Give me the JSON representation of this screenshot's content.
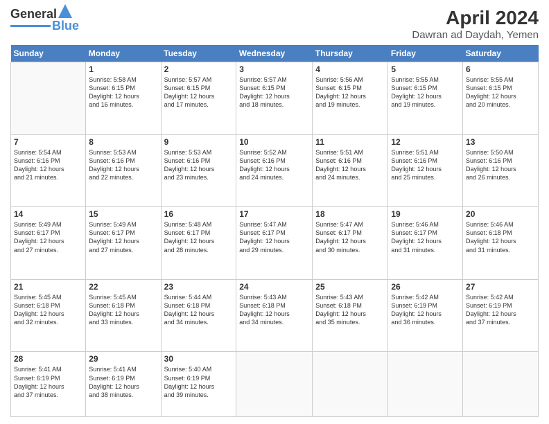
{
  "header": {
    "logo": {
      "line1": "General",
      "line2": "Blue"
    },
    "title": "April 2024",
    "location": "Dawran ad Daydah, Yemen"
  },
  "days_of_week": [
    "Sunday",
    "Monday",
    "Tuesday",
    "Wednesday",
    "Thursday",
    "Friday",
    "Saturday"
  ],
  "weeks": [
    [
      {
        "day": "",
        "info": ""
      },
      {
        "day": "1",
        "info": "Sunrise: 5:58 AM\nSunset: 6:15 PM\nDaylight: 12 hours\nand 16 minutes."
      },
      {
        "day": "2",
        "info": "Sunrise: 5:57 AM\nSunset: 6:15 PM\nDaylight: 12 hours\nand 17 minutes."
      },
      {
        "day": "3",
        "info": "Sunrise: 5:57 AM\nSunset: 6:15 PM\nDaylight: 12 hours\nand 18 minutes."
      },
      {
        "day": "4",
        "info": "Sunrise: 5:56 AM\nSunset: 6:15 PM\nDaylight: 12 hours\nand 19 minutes."
      },
      {
        "day": "5",
        "info": "Sunrise: 5:55 AM\nSunset: 6:15 PM\nDaylight: 12 hours\nand 19 minutes."
      },
      {
        "day": "6",
        "info": "Sunrise: 5:55 AM\nSunset: 6:15 PM\nDaylight: 12 hours\nand 20 minutes."
      }
    ],
    [
      {
        "day": "7",
        "info": "Sunrise: 5:54 AM\nSunset: 6:16 PM\nDaylight: 12 hours\nand 21 minutes."
      },
      {
        "day": "8",
        "info": "Sunrise: 5:53 AM\nSunset: 6:16 PM\nDaylight: 12 hours\nand 22 minutes."
      },
      {
        "day": "9",
        "info": "Sunrise: 5:53 AM\nSunset: 6:16 PM\nDaylight: 12 hours\nand 23 minutes."
      },
      {
        "day": "10",
        "info": "Sunrise: 5:52 AM\nSunset: 6:16 PM\nDaylight: 12 hours\nand 24 minutes."
      },
      {
        "day": "11",
        "info": "Sunrise: 5:51 AM\nSunset: 6:16 PM\nDaylight: 12 hours\nand 24 minutes."
      },
      {
        "day": "12",
        "info": "Sunrise: 5:51 AM\nSunset: 6:16 PM\nDaylight: 12 hours\nand 25 minutes."
      },
      {
        "day": "13",
        "info": "Sunrise: 5:50 AM\nSunset: 6:16 PM\nDaylight: 12 hours\nand 26 minutes."
      }
    ],
    [
      {
        "day": "14",
        "info": "Sunrise: 5:49 AM\nSunset: 6:17 PM\nDaylight: 12 hours\nand 27 minutes."
      },
      {
        "day": "15",
        "info": "Sunrise: 5:49 AM\nSunset: 6:17 PM\nDaylight: 12 hours\nand 27 minutes."
      },
      {
        "day": "16",
        "info": "Sunrise: 5:48 AM\nSunset: 6:17 PM\nDaylight: 12 hours\nand 28 minutes."
      },
      {
        "day": "17",
        "info": "Sunrise: 5:47 AM\nSunset: 6:17 PM\nDaylight: 12 hours\nand 29 minutes."
      },
      {
        "day": "18",
        "info": "Sunrise: 5:47 AM\nSunset: 6:17 PM\nDaylight: 12 hours\nand 30 minutes."
      },
      {
        "day": "19",
        "info": "Sunrise: 5:46 AM\nSunset: 6:17 PM\nDaylight: 12 hours\nand 31 minutes."
      },
      {
        "day": "20",
        "info": "Sunrise: 5:46 AM\nSunset: 6:18 PM\nDaylight: 12 hours\nand 31 minutes."
      }
    ],
    [
      {
        "day": "21",
        "info": "Sunrise: 5:45 AM\nSunset: 6:18 PM\nDaylight: 12 hours\nand 32 minutes."
      },
      {
        "day": "22",
        "info": "Sunrise: 5:45 AM\nSunset: 6:18 PM\nDaylight: 12 hours\nand 33 minutes."
      },
      {
        "day": "23",
        "info": "Sunrise: 5:44 AM\nSunset: 6:18 PM\nDaylight: 12 hours\nand 34 minutes."
      },
      {
        "day": "24",
        "info": "Sunrise: 5:43 AM\nSunset: 6:18 PM\nDaylight: 12 hours\nand 34 minutes."
      },
      {
        "day": "25",
        "info": "Sunrise: 5:43 AM\nSunset: 6:18 PM\nDaylight: 12 hours\nand 35 minutes."
      },
      {
        "day": "26",
        "info": "Sunrise: 5:42 AM\nSunset: 6:19 PM\nDaylight: 12 hours\nand 36 minutes."
      },
      {
        "day": "27",
        "info": "Sunrise: 5:42 AM\nSunset: 6:19 PM\nDaylight: 12 hours\nand 37 minutes."
      }
    ],
    [
      {
        "day": "28",
        "info": "Sunrise: 5:41 AM\nSunset: 6:19 PM\nDaylight: 12 hours\nand 37 minutes."
      },
      {
        "day": "29",
        "info": "Sunrise: 5:41 AM\nSunset: 6:19 PM\nDaylight: 12 hours\nand 38 minutes."
      },
      {
        "day": "30",
        "info": "Sunrise: 5:40 AM\nSunset: 6:19 PM\nDaylight: 12 hours\nand 39 minutes."
      },
      {
        "day": "",
        "info": ""
      },
      {
        "day": "",
        "info": ""
      },
      {
        "day": "",
        "info": ""
      },
      {
        "day": "",
        "info": ""
      }
    ]
  ]
}
